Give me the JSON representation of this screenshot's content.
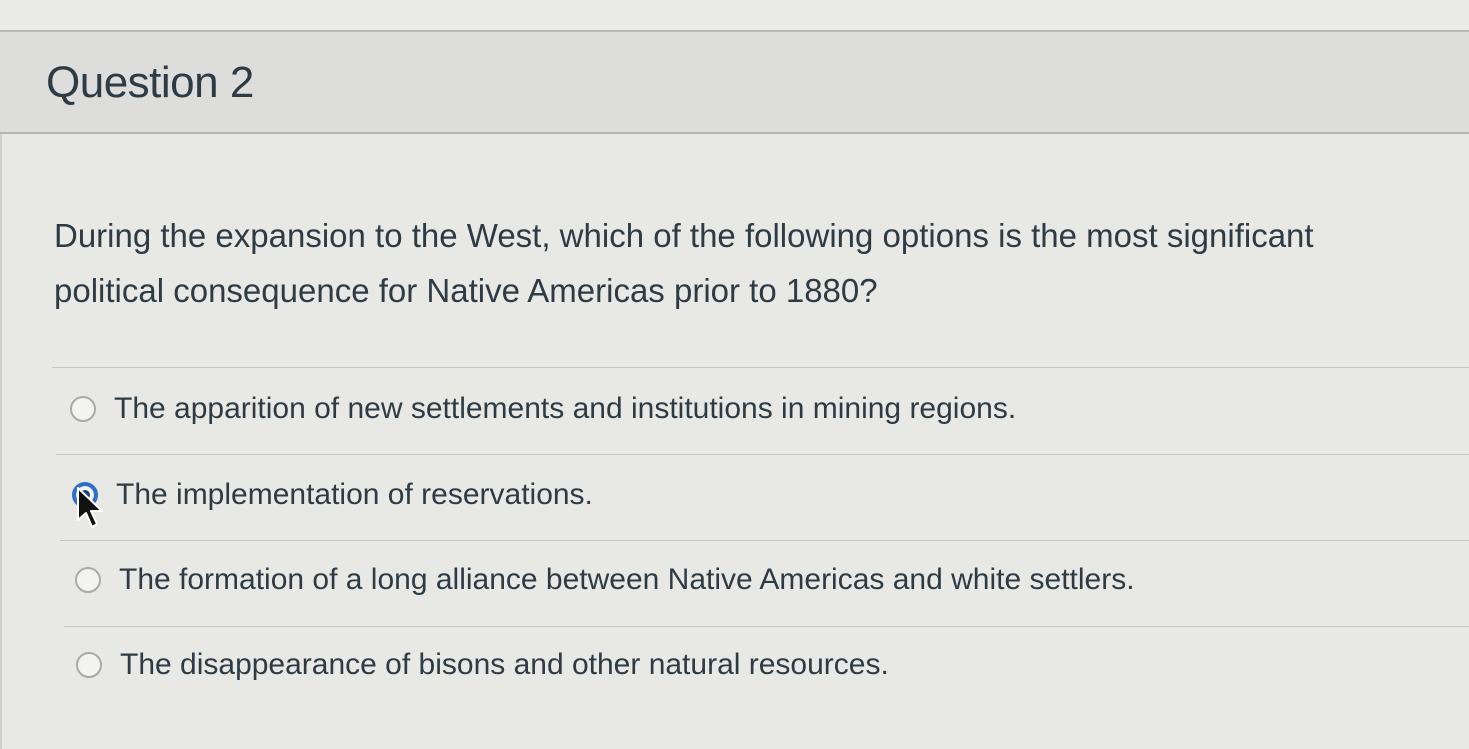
{
  "question": {
    "title": "Question 2",
    "text_line1": "During the expansion to the West, which of the following options is the most significant",
    "text_line2": "political consequence for Native Americas prior to 1880?"
  },
  "answers": [
    {
      "label": "The apparition of new settlements and institutions in mining regions.",
      "selected": false
    },
    {
      "label": "The implementation of reservations.",
      "selected": true
    },
    {
      "label": "The formation of a long alliance between Native Americas and white settlers.",
      "selected": false
    },
    {
      "label": "The disappearance of bisons and other natural resources.",
      "selected": false
    }
  ],
  "colors": {
    "selected_radio": "#2f6fca",
    "text": "#2d3b45"
  }
}
